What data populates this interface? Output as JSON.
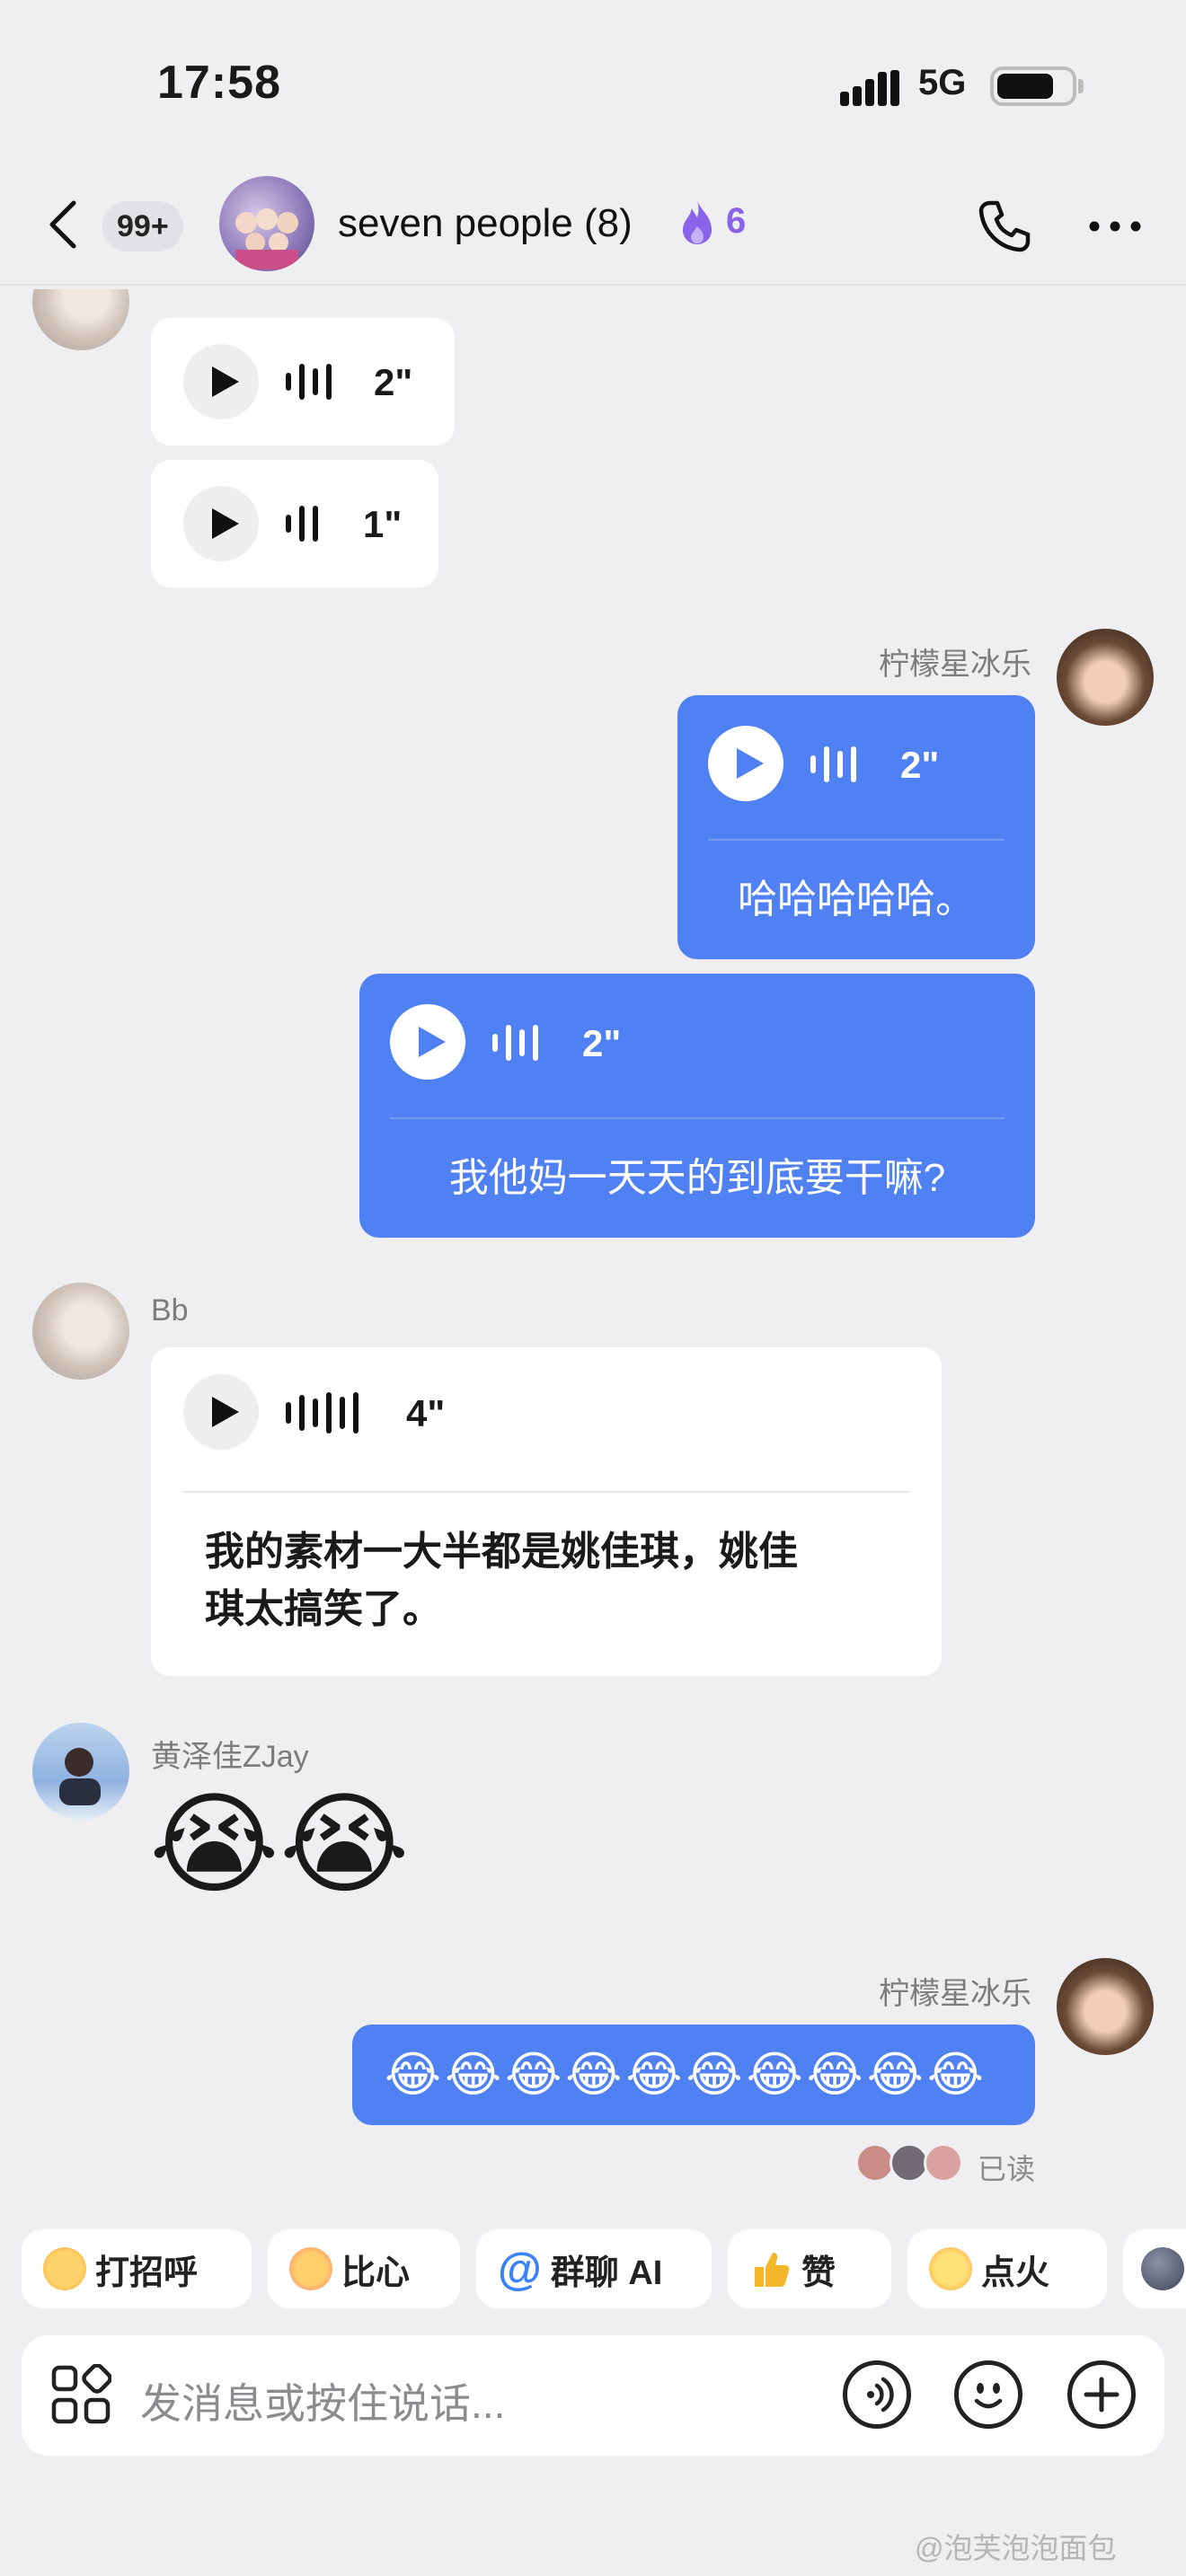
{
  "status_bar": {
    "time": "17:58",
    "network": "5G",
    "battery_level": 0.78
  },
  "header": {
    "unread_count": "99+",
    "group_name": "seven people (8)",
    "fire_count": "6"
  },
  "messages": [
    {
      "sender": "Bb",
      "durations": [
        "2\"",
        "1\""
      ]
    },
    {
      "sender": "柠檬星冰乐",
      "duration": "2\"",
      "text": "哈哈哈哈哈。"
    },
    {
      "duration": "2\"",
      "text": "我他妈一天天的到底要干嘛?"
    },
    {
      "sender": "Bb",
      "duration": "4\"",
      "text_line1": "我的素材一大半都是姚佳琪，姚佳",
      "text_line2": "琪太搞笑了。"
    },
    {
      "sender": "黄泽佳ZJay",
      "emojis": "😭😭"
    },
    {
      "sender": "柠檬星冰乐",
      "emojis": "😂😂😂😂😂😂😂😂😂😂",
      "status": "已读"
    }
  ],
  "quick_replies": [
    "打招呼",
    "比心",
    "群聊 AI",
    "赞",
    "点火"
  ],
  "input": {
    "placeholder": "发消息或按住说话..."
  },
  "watermark": "@泡芙泡泡面包",
  "colors": {
    "accent_blue": "#4f81f3",
    "fire_purple": "#8a63e8",
    "background": "#efeff1"
  }
}
